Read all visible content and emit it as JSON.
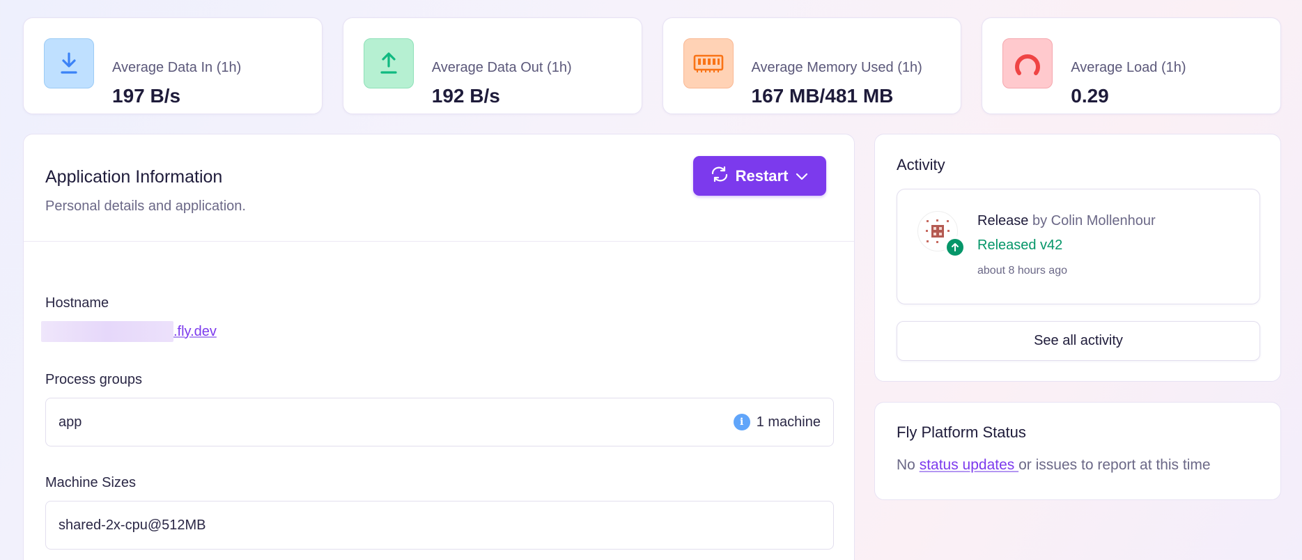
{
  "stats": [
    {
      "label": "Average Data In (1h)",
      "value": "197 B/s",
      "icon": "download-icon",
      "color": "#3b82f6"
    },
    {
      "label": "Average Data Out (1h)",
      "value": "192 B/s",
      "icon": "upload-icon",
      "color": "#10b981"
    },
    {
      "label": "Average Memory Used (1h)",
      "value": "167 MB/481 MB",
      "icon": "memory-icon",
      "color": "#f97316"
    },
    {
      "label": "Average Load (1h)",
      "value": "0.29",
      "icon": "gauge-icon",
      "color": "#ef4444"
    }
  ],
  "app": {
    "title": "Application Information",
    "subtitle": "Personal details and application.",
    "restart_label": "Restart",
    "hostname_label": "Hostname",
    "hostname_suffix": ".fly.dev",
    "process_groups_label": "Process groups",
    "process_group_name": "app",
    "process_group_count": "1 machine",
    "machine_sizes_label": "Machine Sizes",
    "machine_size": "shared-2x-cpu@512MB"
  },
  "activity": {
    "title": "Activity",
    "release_type": "Release",
    "release_by": "by Colin Mollenhour",
    "release_version": "Released v42",
    "release_time": "about 8 hours ago",
    "see_all_label": "See all activity"
  },
  "status": {
    "title": "Fly Platform Status",
    "text_before": "No ",
    "link_text": "status updates ",
    "text_after": "or issues to report at this time"
  },
  "colors": {
    "accent": "#7c3aed",
    "success": "#059669"
  }
}
